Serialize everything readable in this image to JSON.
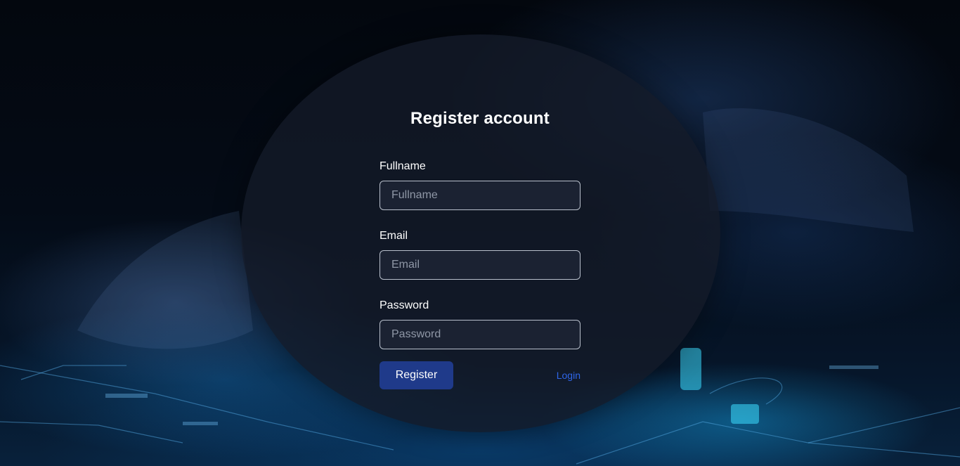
{
  "form": {
    "title": "Register account",
    "fullname": {
      "label": "Fullname",
      "placeholder": "Fullname",
      "value": ""
    },
    "email": {
      "label": "Email",
      "placeholder": "Email",
      "value": ""
    },
    "password": {
      "label": "Password",
      "placeholder": "Password",
      "value": ""
    },
    "register_label": "Register",
    "login_label": "Login"
  },
  "colors": {
    "card": "#141a28",
    "button": "#1f3a8a",
    "link": "#2f66e8",
    "input_bg": "#1b2232",
    "input_border": "#b9c0cc"
  }
}
